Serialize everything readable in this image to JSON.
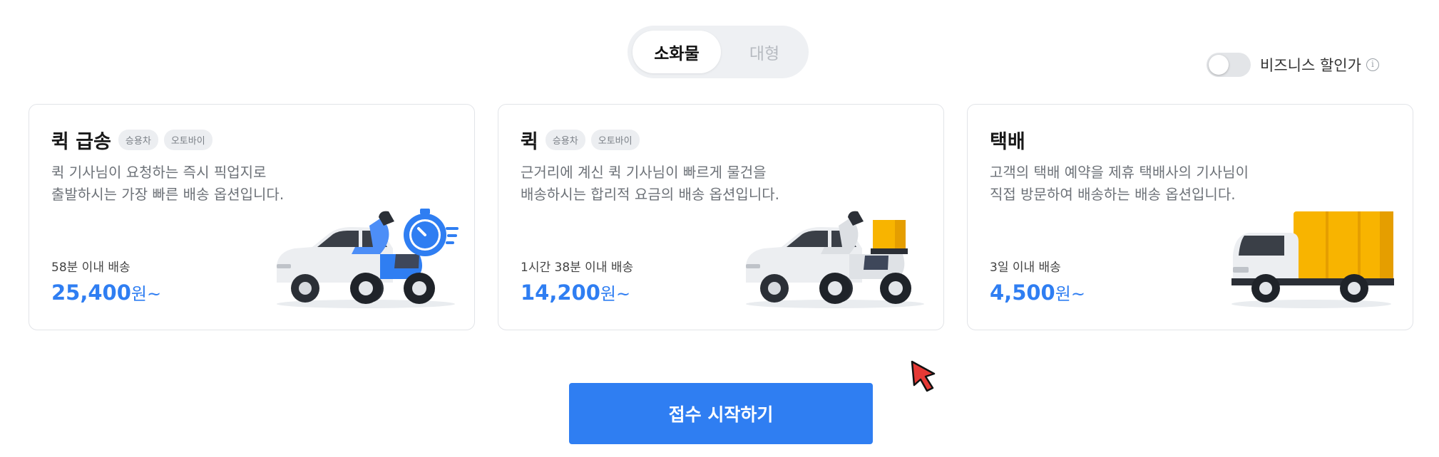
{
  "segment": {
    "options": [
      "소화물",
      "대형"
    ],
    "selected": "소화물"
  },
  "business": {
    "label": "비즈니스 할인가",
    "enabled": false,
    "info_glyph": "i"
  },
  "cards": [
    {
      "title": "퀵 급송",
      "tags": [
        "승용차",
        "오토바이"
      ],
      "desc": [
        "퀵 기사님이 요청하는 즉시 픽업지로",
        "출발하시는 가장 빠른 배송 옵션입니다."
      ],
      "eta": "58분 이내 배송",
      "price": "25,400",
      "unit": "원~",
      "illustration": "car-scooter-timer"
    },
    {
      "title": "퀵",
      "tags": [
        "승용차",
        "오토바이"
      ],
      "desc": [
        "근거리에 계신 퀵 기사님이 빠르게 물건을",
        "배송하시는 합리적 요금의 배송 옵션입니다."
      ],
      "eta": "1시간 38분 이내 배송",
      "price": "14,200",
      "unit": "원~",
      "illustration": "car-scooter-box"
    },
    {
      "title": "택배",
      "tags": [],
      "desc": [
        "고객의 택배 예약을 제휴 택배사의 기사님이",
        "직접 방문하여 배송하는 배송 옵션입니다."
      ],
      "eta": "3일 이내 배송",
      "price": "4,500",
      "unit": "원~",
      "illustration": "delivery-truck"
    }
  ],
  "cta": {
    "label": "접수 시작하기"
  },
  "colors": {
    "accent": "#2f7ef2",
    "delivery_yellow": "#f8b400",
    "timer_blue": "#2f7ef2"
  }
}
